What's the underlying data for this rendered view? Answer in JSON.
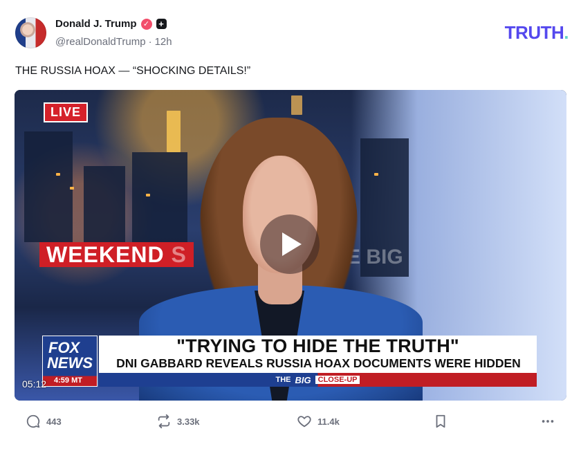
{
  "post": {
    "author": {
      "display_name": "Donald J. Trump",
      "handle": "@realDonaldTrump",
      "separator": "·",
      "time": "12h",
      "verified_icon": "verified-badge-icon",
      "plus_icon": "plus-icon"
    },
    "brand": {
      "logo_main": "TRUTH",
      "logo_dot": "."
    },
    "text": "THE RUSSIA HOAX — “SHOCKING DETAILS!”",
    "media": {
      "duration": "05:12",
      "live_badge": "LIVE",
      "sign_text": "WEEKEND",
      "sign_partial": "S",
      "sign_partial_right": "E BIG",
      "fox_logo_top": "FOX",
      "fox_logo_bottom": "NEWS",
      "fox_time": "4:59 MT",
      "headline_main": "\"TRYING TO HIDE THE TRUTH\"",
      "headline_sub": "DNI GABBARD REVEALS RUSSIA HOAX DOCUMENTS WERE HIDDEN",
      "ticker_prefix": "THE",
      "ticker_big": "BIG",
      "ticker_suffix": "CLOSE-UP"
    },
    "actions": {
      "replies": "443",
      "retruths": "3.33k",
      "likes": "11.4k"
    }
  },
  "colors": {
    "brand_purple": "#5448ee",
    "brand_teal": "#62d4c7",
    "verified_pink": "#f24e6b",
    "muted": "#6b6f7b"
  }
}
